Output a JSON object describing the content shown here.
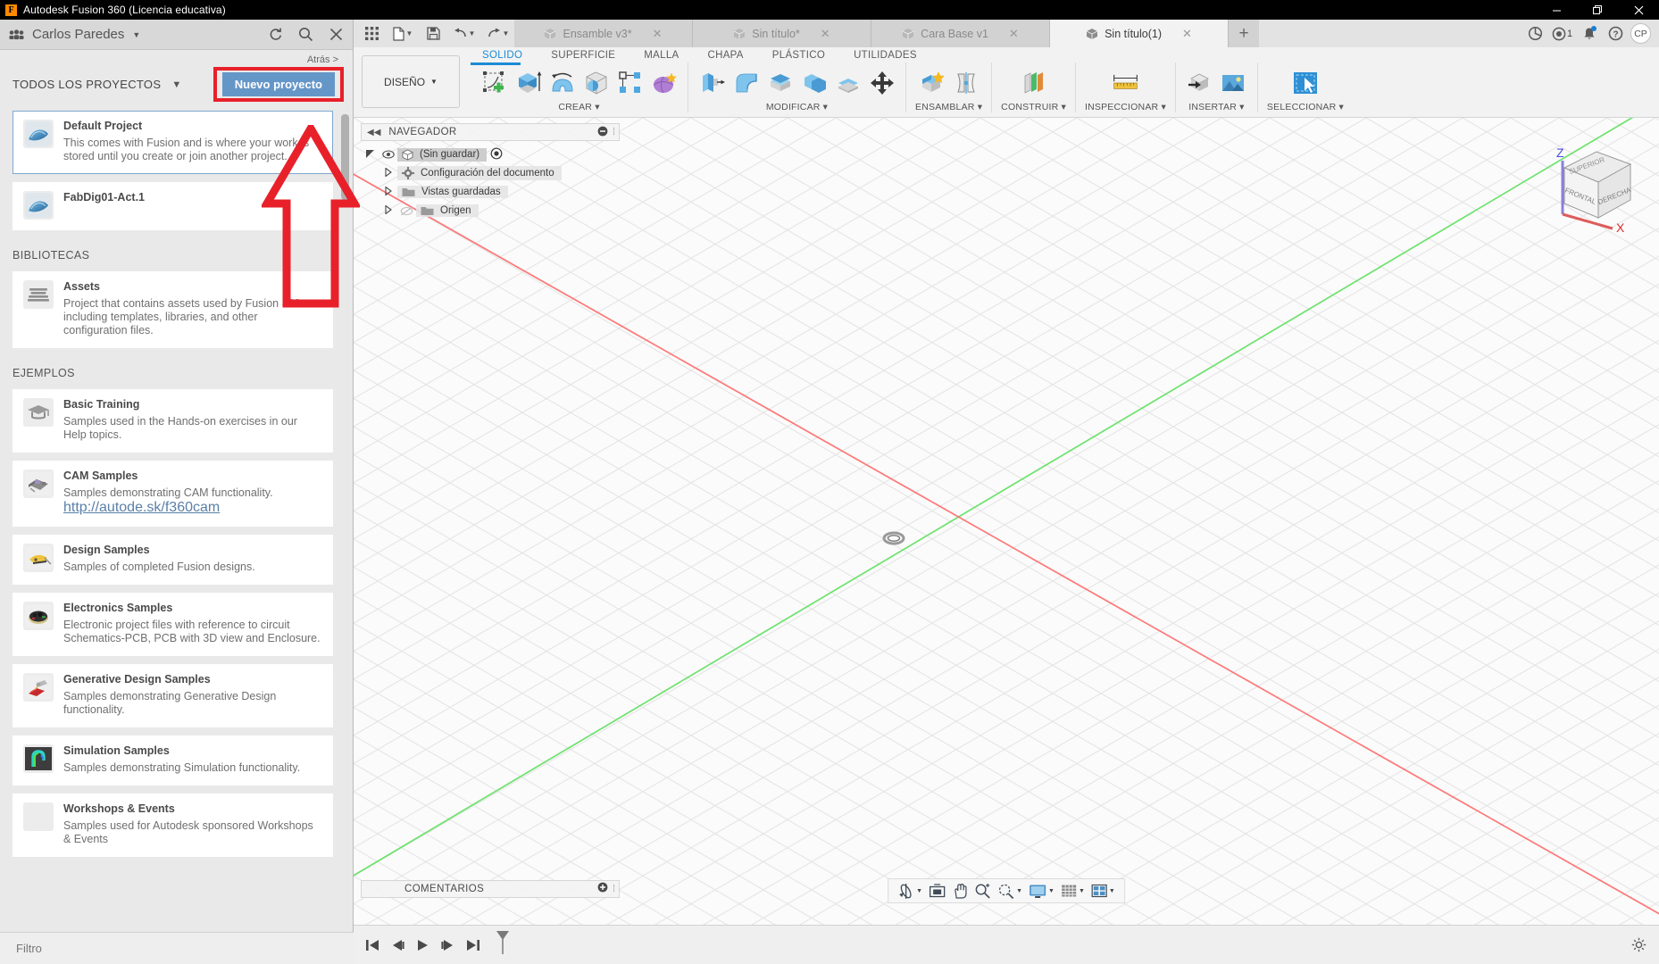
{
  "window": {
    "title": "Autodesk Fusion 360 (Licencia educativa)",
    "logo_letter": "F",
    "minimize_icon": "minimize-icon",
    "restore_icon": "restore-icon",
    "close_icon": "close-icon"
  },
  "data_panel": {
    "user_name": "Carlos Paredes",
    "refresh_icon": "refresh-icon",
    "search_icon": "search-icon",
    "close_icon": "close-panel-icon",
    "back_label": "Atrás >",
    "all_projects_label": "TODOS LOS PROYECTOS",
    "new_project_label": "Nuevo proyecto",
    "filter_placeholder": "Filtro",
    "projects": [
      {
        "title": "Default Project",
        "desc": "This comes with Fusion and is where your work is stored until you create or join another project.",
        "selected": true
      },
      {
        "title": "FabDig01-Act.1",
        "desc": "",
        "selected": false
      }
    ],
    "libraries_header": "BIBLIOTECAS",
    "libraries": [
      {
        "title": "Assets",
        "desc": "Project that contains assets used by Fusion 360 including templates, libraries, and other configuration files."
      }
    ],
    "examples_header": "EJEMPLOS",
    "examples": [
      {
        "title": "Basic Training",
        "desc": "Samples used in the Hands-on exercises in our Help topics.",
        "link": ""
      },
      {
        "title": "CAM Samples",
        "desc": "Samples demonstrating CAM functionality.",
        "link": "http://autode.sk/f360cam"
      },
      {
        "title": "Design Samples",
        "desc": "Samples of completed Fusion designs.",
        "link": ""
      },
      {
        "title": "Electronics Samples",
        "desc": "Electronic project files with reference to circuit Schematics-PCB, PCB with 3D view and Enclosure.",
        "link": ""
      },
      {
        "title": "Generative Design Samples",
        "desc": "Samples demonstrating Generative Design functionality.",
        "link": ""
      },
      {
        "title": "Simulation Samples",
        "desc": "Samples demonstrating Simulation functionality.",
        "link": ""
      },
      {
        "title": "Workshops & Events",
        "desc": "Samples used for Autodesk sponsored Workshops & Events",
        "link": ""
      }
    ]
  },
  "annotation": {
    "highlight_color": "#e8202a",
    "arrow_name": "red-arrow-pointing-to-new-project",
    "box_name": "red-highlight-box-new-project"
  },
  "quick_access": {
    "grid_icon": "app-grid-icon",
    "new_icon": "new-file-icon",
    "save_icon": "save-icon",
    "undo_icon": "undo-icon",
    "redo_icon": "redo-icon"
  },
  "tabs": [
    {
      "label": "Ensamble v3*",
      "active": false,
      "closable": true
    },
    {
      "label": "Sin título*",
      "active": false,
      "closable": true
    },
    {
      "label": "Cara Base v1",
      "active": false,
      "closable": true
    },
    {
      "label": "Sin título(1)",
      "active": true,
      "closable": true
    }
  ],
  "tab_add_label": "+",
  "account_bar": {
    "extension_icon": "extension-icon",
    "job_status_icon": "job-status-icon",
    "job_count": "1",
    "notifications_icon": "bell-icon",
    "help_icon": "help-icon",
    "avatar_initials": "CP"
  },
  "ribbon": {
    "workspace_label": "DISEÑO",
    "tabs": [
      {
        "label": "SOLIDO",
        "active": true
      },
      {
        "label": "SUPERFICIE",
        "active": false
      },
      {
        "label": "MALLA",
        "active": false
      },
      {
        "label": "CHAPA",
        "active": false
      },
      {
        "label": "PLÁSTICO",
        "active": false
      },
      {
        "label": "UTILIDADES",
        "active": false
      }
    ],
    "panels": [
      {
        "label": "CREAR",
        "tools": [
          "create-sketch-icon",
          "extrude-icon",
          "revolve-icon",
          "sphere-icon",
          "pattern-icon",
          "form-icon"
        ]
      },
      {
        "label": "MODIFICAR",
        "tools": [
          "press-pull-icon",
          "fillet-icon",
          "shell-icon",
          "combine-icon",
          "offset-face-icon",
          "move-copy-icon"
        ]
      },
      {
        "label": "ENSAMBLAR",
        "tools": [
          "new-component-icon",
          "joint-icon"
        ]
      },
      {
        "label": "CONSTRUIR",
        "tools": [
          "offset-plane-icon"
        ]
      },
      {
        "label": "INSPECCIONAR",
        "tools": [
          "measure-icon"
        ]
      },
      {
        "label": "INSERTAR",
        "tools": [
          "insert-derive-icon",
          "insert-canvas-icon"
        ]
      },
      {
        "label": "SELECCIONAR",
        "tools": [
          "select-window-icon"
        ]
      }
    ]
  },
  "browser": {
    "title": "NAVEGADOR",
    "collapse_icon": "collapse-left-icon",
    "minimize_icon": "minus-circle-icon",
    "nodes": [
      {
        "label": "(Sin guardar)",
        "icon": "document-icon",
        "level": 0,
        "selected": true,
        "has_eye": true,
        "has_radio": true
      },
      {
        "label": "Configuración del documento",
        "icon": "gear-icon",
        "level": 1,
        "selected": false,
        "has_eye": false,
        "has_radio": false
      },
      {
        "label": "Vistas guardadas",
        "icon": "folder-icon",
        "level": 1,
        "selected": false,
        "has_eye": false,
        "has_radio": false
      },
      {
        "label": "Origen",
        "icon": "folder-icon",
        "level": 1,
        "selected": false,
        "has_eye": true,
        "has_radio": false
      }
    ]
  },
  "viewcube": {
    "front_label": "FRONTAL",
    "right_label": "DERECHA",
    "top_label": "SUPERIOR",
    "axis_z": "Z",
    "axis_x": "X"
  },
  "comments": {
    "title": "COMENTARIOS",
    "add_icon": "add-comment-icon"
  },
  "nav_bar": {
    "items": [
      {
        "icon": "orbit-icon",
        "has_caret": true
      },
      {
        "icon": "look-at-icon",
        "has_caret": false
      },
      {
        "icon": "pan-icon",
        "has_caret": false
      },
      {
        "icon": "zoom-icon",
        "has_caret": false
      },
      {
        "icon": "fit-icon",
        "has_caret": true
      },
      {
        "icon": "display-settings-icon",
        "has_caret": true
      },
      {
        "icon": "grid-snap-icon",
        "has_caret": true
      },
      {
        "icon": "viewports-icon",
        "has_caret": true
      }
    ]
  },
  "timeline": {
    "buttons": [
      "go-to-beginning-icon",
      "step-back-icon",
      "play-icon",
      "step-forward-icon",
      "go-to-end-icon"
    ],
    "marker_icon": "timeline-marker-icon",
    "settings_icon": "timeline-settings-icon"
  },
  "canvas": {
    "origin_icon": "origin-point-icon",
    "x_axis_color": "#ff4d4d",
    "y_axis_color": "#4ddd4d",
    "grid_color": "#e3e3e3"
  }
}
